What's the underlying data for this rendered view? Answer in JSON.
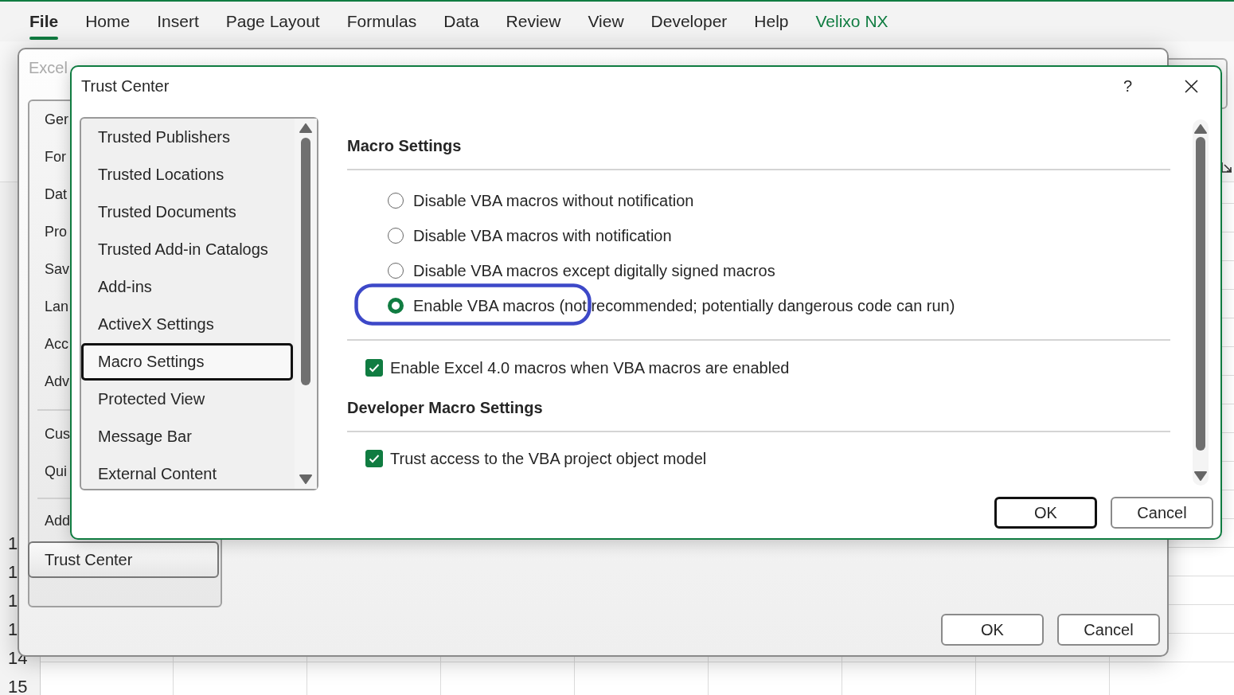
{
  "ribbon_tabs": [
    {
      "label": "File",
      "selected": true,
      "color": "#262626"
    },
    {
      "label": "Home",
      "selected": false,
      "color": "#262626"
    },
    {
      "label": "Insert",
      "selected": false,
      "color": "#262626"
    },
    {
      "label": "Page Layout",
      "selected": false,
      "color": "#262626"
    },
    {
      "label": "Formulas",
      "selected": false,
      "color": "#262626"
    },
    {
      "label": "Data",
      "selected": false,
      "color": "#262626"
    },
    {
      "label": "Review",
      "selected": false,
      "color": "#262626"
    },
    {
      "label": "View",
      "selected": false,
      "color": "#262626"
    },
    {
      "label": "Developer",
      "selected": false,
      "color": "#262626"
    },
    {
      "label": "Help",
      "selected": false,
      "color": "#262626"
    },
    {
      "label": "Velixo NX",
      "selected": false,
      "color": "#107c41"
    }
  ],
  "sheet": {
    "row_numbers": [
      "1",
      "1",
      "1",
      "1",
      "14",
      "15"
    ]
  },
  "options_window": {
    "title": "Excel",
    "nav_groups": [
      [
        {
          "label": "Ger",
          "selected": false
        },
        {
          "label": "For",
          "selected": false
        },
        {
          "label": "Dat",
          "selected": false
        },
        {
          "label": "Pro",
          "selected": false
        },
        {
          "label": "Sav",
          "selected": false
        },
        {
          "label": "Lan",
          "selected": false
        },
        {
          "label": "Acc",
          "selected": false
        },
        {
          "label": "Adv",
          "selected": false
        }
      ],
      [
        {
          "label": "Cus",
          "selected": false
        },
        {
          "label": "Qui",
          "selected": false
        }
      ],
      [
        {
          "label": "Add",
          "selected": false
        },
        {
          "label": "Trust Center",
          "selected": true
        }
      ]
    ],
    "buttons": [
      "OK",
      "Cancel"
    ]
  },
  "trust_center": {
    "title": "Trust Center",
    "help": "?",
    "categories": [
      {
        "label": "Trusted Publishers",
        "selected": false
      },
      {
        "label": "Trusted Locations",
        "selected": false
      },
      {
        "label": "Trusted Documents",
        "selected": false
      },
      {
        "label": "Trusted Add-in Catalogs",
        "selected": false
      },
      {
        "label": "Add-ins",
        "selected": false
      },
      {
        "label": "ActiveX Settings",
        "selected": false
      },
      {
        "label": "Macro Settings",
        "selected": true
      },
      {
        "label": "Protected View",
        "selected": false
      },
      {
        "label": "Message Bar",
        "selected": false
      },
      {
        "label": "External Content",
        "selected": false
      }
    ],
    "sections": [
      {
        "heading": "Macro Settings",
        "items": [
          {
            "kind": "radio",
            "label": "Disable VBA macros without notification",
            "selected": false,
            "highlighted": false
          },
          {
            "kind": "radio",
            "label": "Disable VBA macros with notification",
            "selected": false,
            "highlighted": false
          },
          {
            "kind": "radio",
            "label": "Disable VBA macros except digitally signed macros",
            "selected": false,
            "highlighted": false
          },
          {
            "kind": "radio",
            "label": "Enable VBA macros (not recommended; potentially dangerous code can run)",
            "selected": true,
            "highlighted": true
          },
          {
            "kind": "checkbox",
            "label": "Enable Excel 4.0 macros when VBA macros are enabled",
            "checked": true
          }
        ]
      },
      {
        "heading": "Developer Macro Settings",
        "items": [
          {
            "kind": "checkbox",
            "label": "Trust access to the VBA project object model",
            "checked": true
          }
        ]
      }
    ],
    "buttons": [
      {
        "label": "OK",
        "default": true
      },
      {
        "label": "Cancel",
        "default": false
      }
    ]
  }
}
